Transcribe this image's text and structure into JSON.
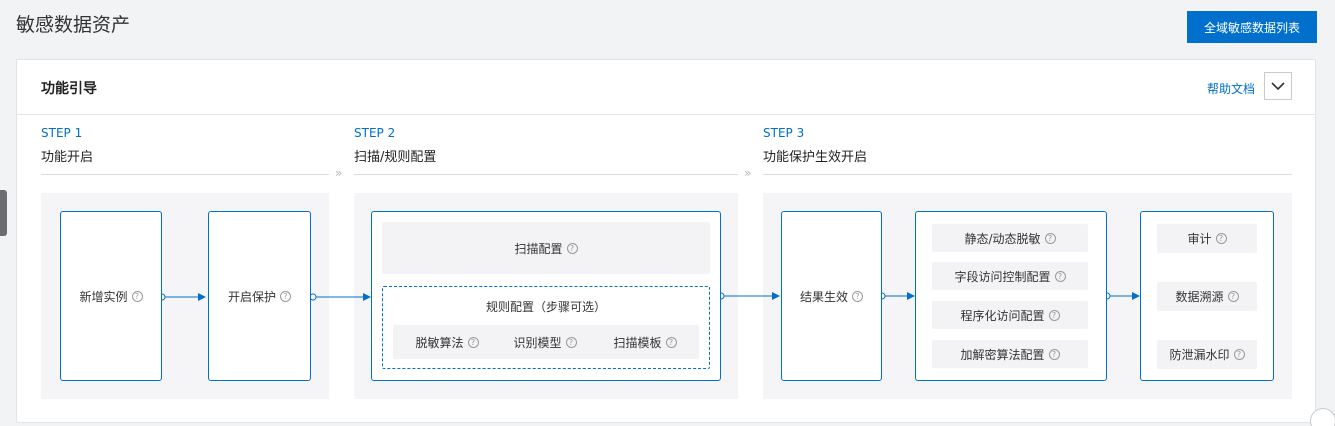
{
  "header": {
    "title": "敏感数据资产",
    "list_button": "全域敏感数据列表"
  },
  "guide": {
    "title": "功能引导",
    "help_link": "帮助文档"
  },
  "steps": [
    {
      "no": "STEP 1",
      "name": "功能开启"
    },
    {
      "no": "STEP 2",
      "name": "扫描/规则配置"
    },
    {
      "no": "STEP 3",
      "name": "功能保护生效开启"
    }
  ],
  "separator": "»",
  "help_glyph": "?",
  "step1": {
    "add_instance": "新增实例",
    "enable_protection": "开启保护"
  },
  "step2": {
    "scan_config": "扫描配置",
    "rule_config": "规则配置（步骤可选）",
    "items": [
      "脱敏算法",
      "识别模型",
      "扫描模板"
    ]
  },
  "step3": {
    "result": "结果生效",
    "access": [
      "静态/动态脱敏",
      "字段访问控制配置",
      "程序化访问配置",
      "加解密算法配置"
    ],
    "outputs": [
      "审计",
      "数据溯源",
      "防泄漏水印"
    ]
  },
  "colors": {
    "accent": "#0070cc"
  }
}
